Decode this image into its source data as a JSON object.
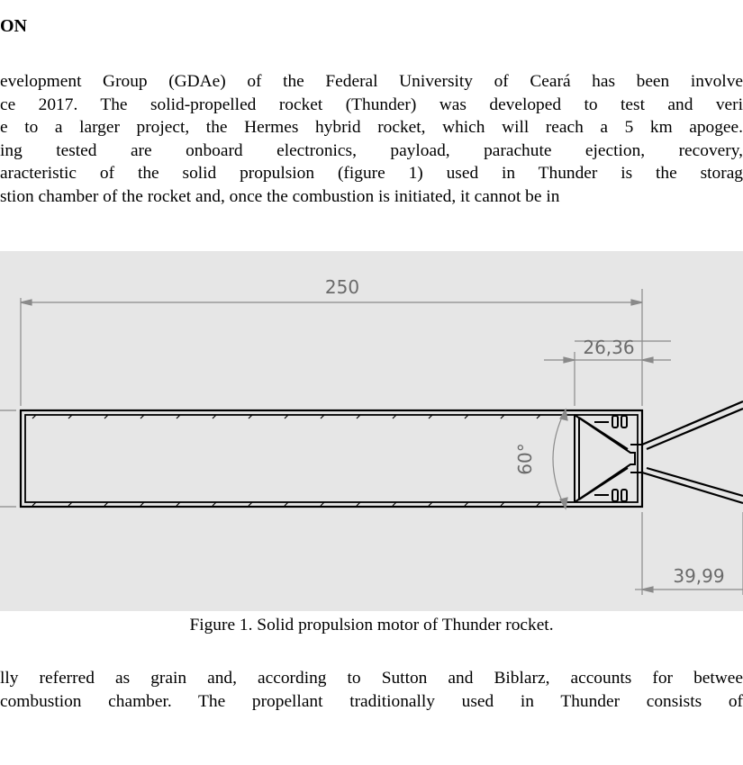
{
  "section": {
    "heading": "ON"
  },
  "intro_paragraph": {
    "lines": [
      "evelopment Group (GDAe) of the Federal University of Ceará has been involve",
      "ce 2017. The solid-propelled rocket (Thunder) was developed to test and veri",
      "e to a larger project, the Hermes hybrid rocket, which will reach a 5 km apogee.",
      "ing tested are onboard electronics, payload, parachute ejection, recovery,",
      "aracteristic of the solid propulsion (figure 1) used in Thunder is the storag",
      "stion chamber of the rocket and, once the combustion is initiated, it cannot be in"
    ]
  },
  "figure": {
    "dimensions": {
      "overall_length": "250",
      "nozzle_section": "26,36",
      "convergence_angle": "60°",
      "nozzle_length": "39,99"
    },
    "caption": "Figure 1.  Solid propulsion motor of Thunder rocket."
  },
  "body_paragraph": {
    "lines": [
      "lly referred as grain and, according to Sutton and Biblarz, accounts for betwee",
      " combustion chamber. The propellant traditionally used in Thunder consists of"
    ]
  },
  "colors": {
    "figure_background": "#e6e6e6",
    "drawing_line": "#000000",
    "dimension_line": "#8a8a8a",
    "dimension_text": "#6a6a6a"
  }
}
